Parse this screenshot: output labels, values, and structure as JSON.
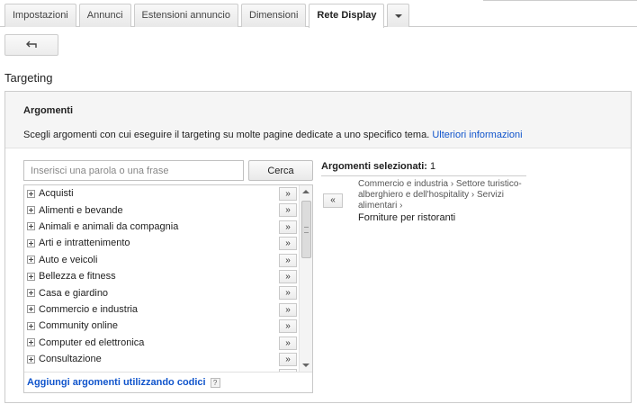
{
  "tabs": [
    {
      "label": "Impostazioni",
      "active": false
    },
    {
      "label": "Annunci",
      "active": false
    },
    {
      "label": "Estensioni annuncio",
      "active": false
    },
    {
      "label": "Dimensioni",
      "active": false
    },
    {
      "label": "Rete Display",
      "active": true
    }
  ],
  "section_title": "Targeting",
  "panel": {
    "title": "Argomenti",
    "description": "Scegli argomenti con cui eseguire il targeting su molte pagine dedicate a uno specifico tema.",
    "learn_more": "Ulteriori informazioni"
  },
  "search": {
    "placeholder": "Inserisci una parola o una frase",
    "button_label": "Cerca"
  },
  "topics": [
    {
      "label": "Acquisti",
      "add": "»"
    },
    {
      "label": "Alimenti e bevande",
      "add": "»"
    },
    {
      "label": "Animali e animali da compagnia",
      "add": "»"
    },
    {
      "label": "Arti e intrattenimento",
      "add": "»"
    },
    {
      "label": "Auto e veicoli",
      "add": "»"
    },
    {
      "label": "Bellezza e fitness",
      "add": "»"
    },
    {
      "label": "Casa e giardino",
      "add": "»"
    },
    {
      "label": "Commercio e industria",
      "add": "»"
    },
    {
      "label": "Community online",
      "add": "»"
    },
    {
      "label": "Computer ed elettronica",
      "add": "»"
    },
    {
      "label": "Consultazione",
      "add": "»"
    }
  ],
  "footer": {
    "codes_link": "Aggiungi argomenti utilizzando codici",
    "help": "?"
  },
  "selected": {
    "heading": "Argomenti selezionati:",
    "count": "1",
    "remove": "«",
    "path": "Commercio e industria › Settore turistico-alberghiero e dell'hospitality › Servizi alimentari ›",
    "name": "Forniture per ristoranti"
  },
  "icons": {
    "back": "back-arrow-icon",
    "more": "caret-down-icon",
    "expand": "plus-icon"
  }
}
